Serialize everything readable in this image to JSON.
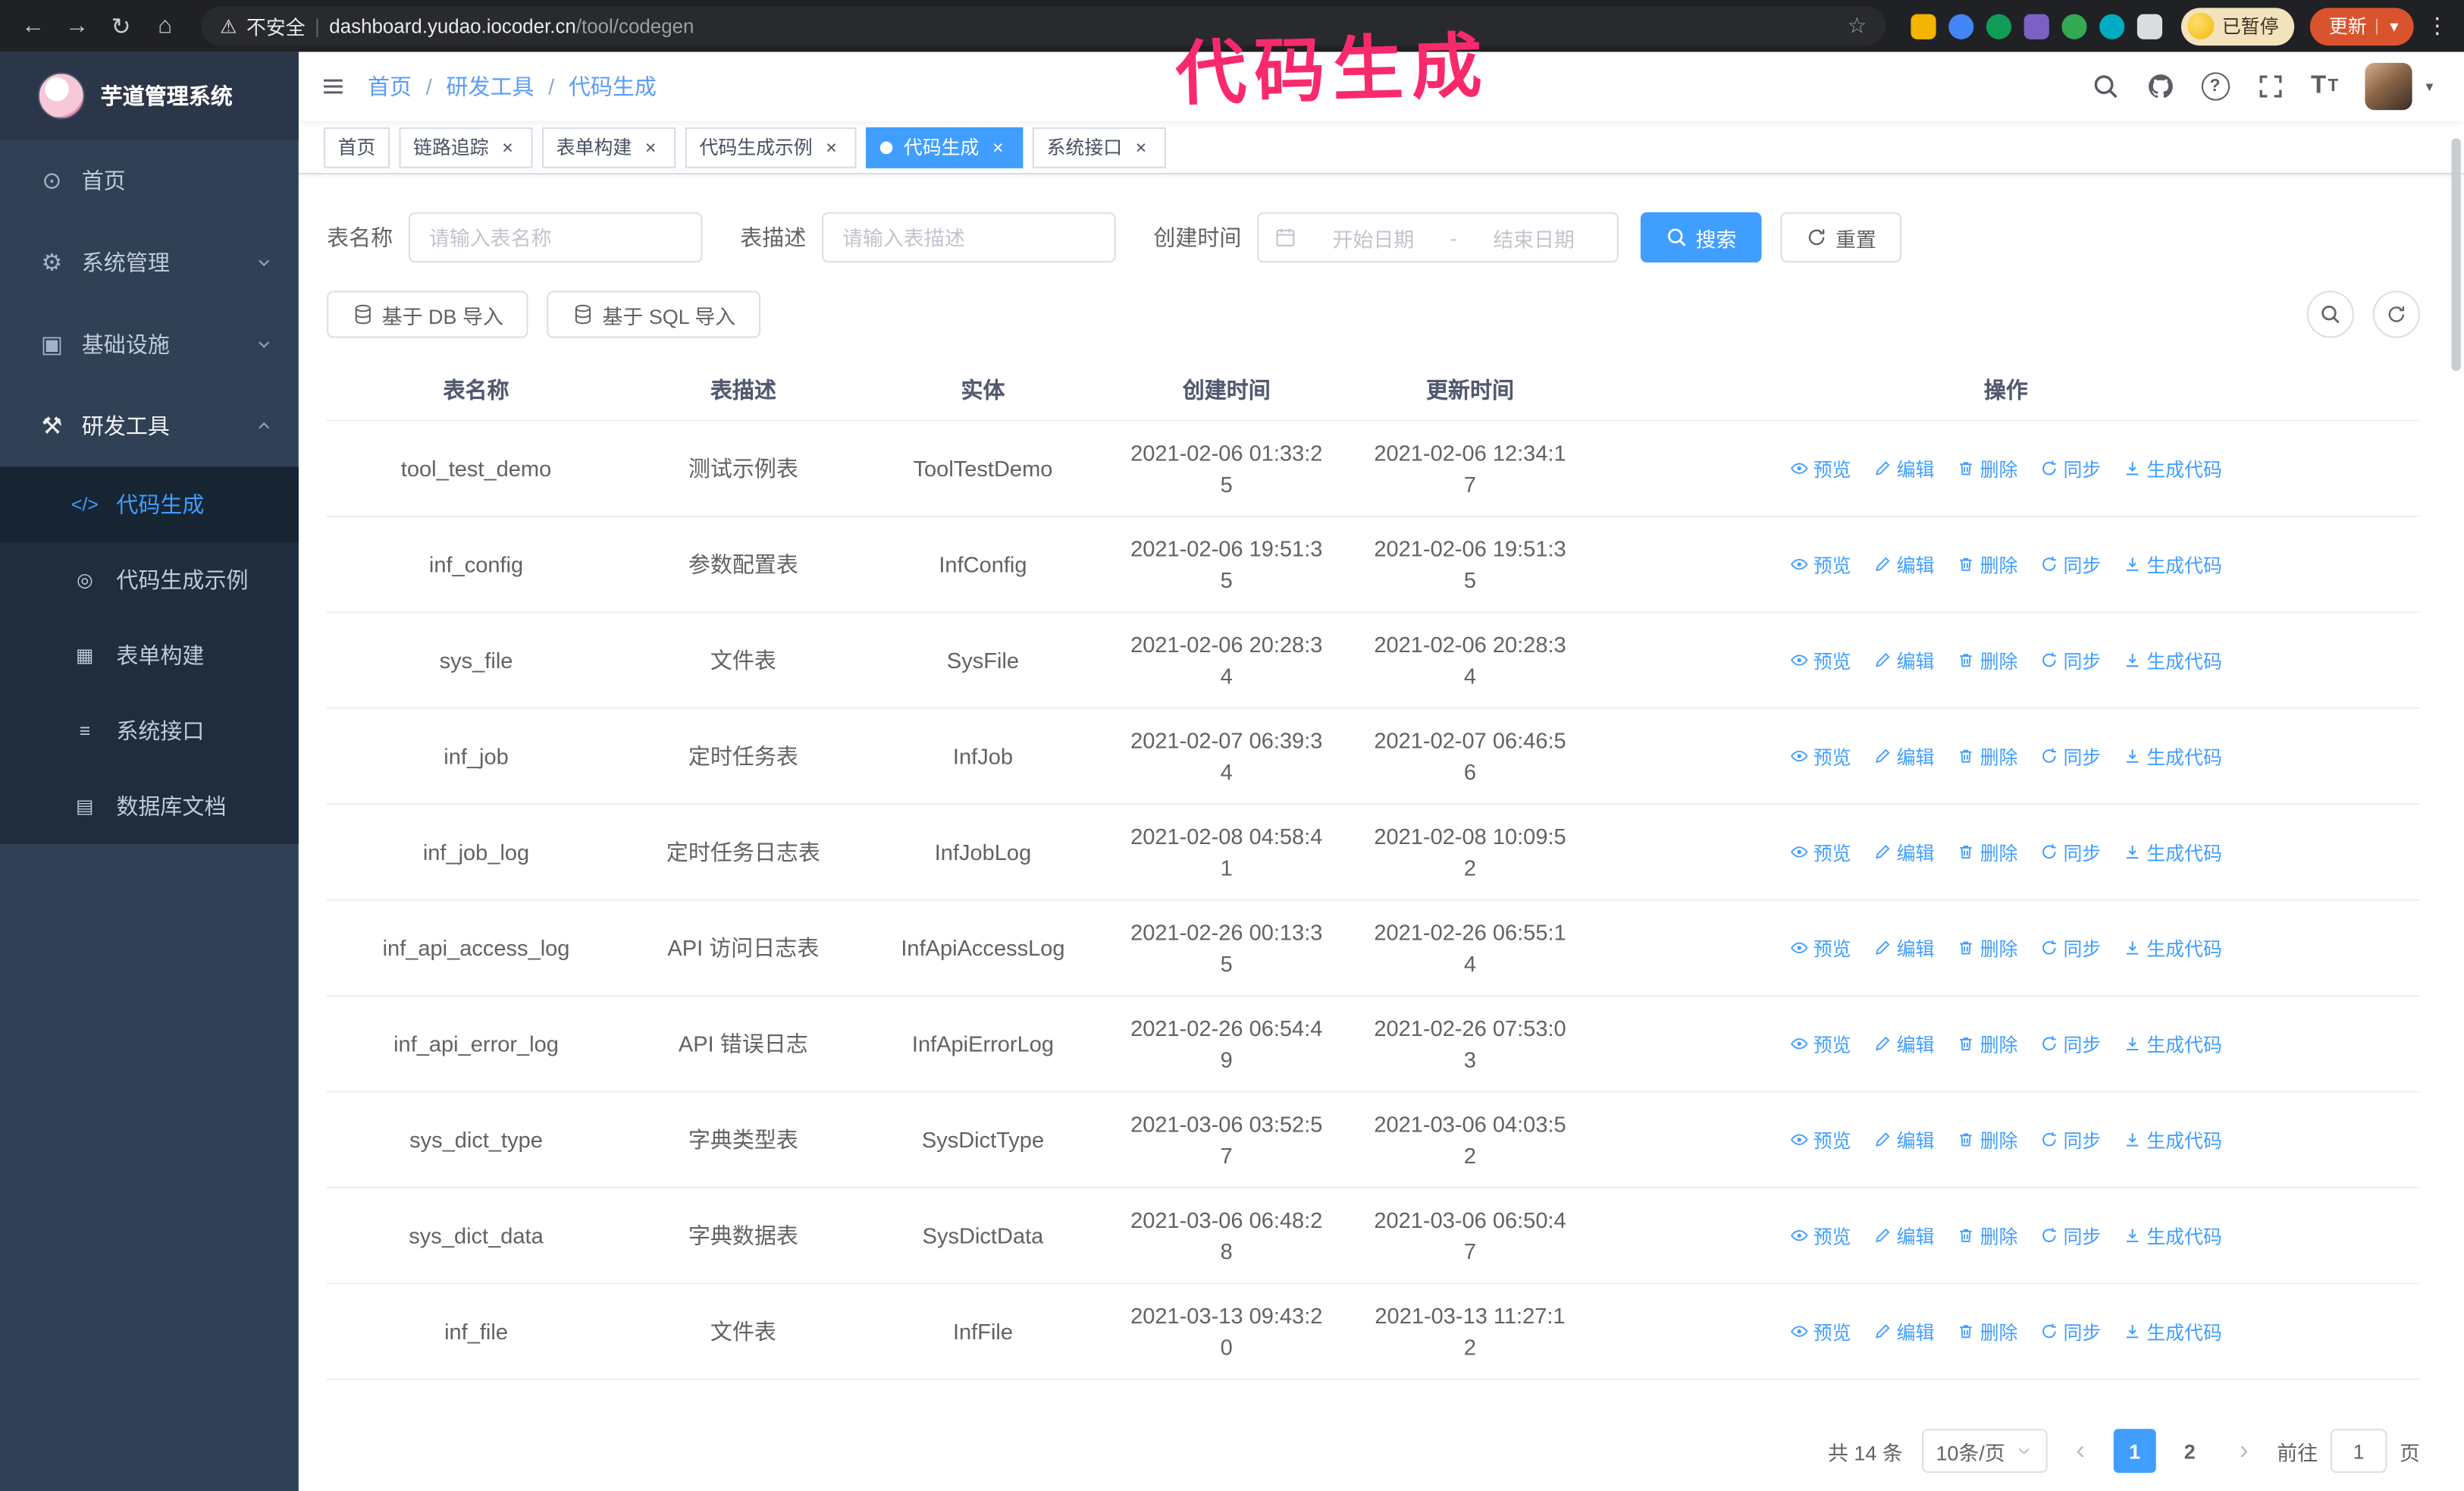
{
  "annotation": {
    "text": "代码生成"
  },
  "browser": {
    "security_label": "不安全",
    "url_host": "dashboard.yudao.iocoder.cn",
    "url_path": "/tool/codegen",
    "profile_badge": "已暂停",
    "update_button": "更新"
  },
  "icons": {
    "back": "←",
    "forward": "→",
    "reload": "↻",
    "home": "⌂",
    "warning": "⚠",
    "star": "☆",
    "kebab": "⋮",
    "close": "×",
    "question": "?",
    "t_large": "T",
    "t_small": "T",
    "avatar_caret": "▼",
    "dashboard": "⊙",
    "settings": "⚙",
    "infra": "▣",
    "tools": "⚒",
    "code": "</>",
    "example": "◎",
    "form": "▦",
    "api": "≡",
    "dbdoc": "▤"
  },
  "sidebar": {
    "logo_title": "芋道管理系统",
    "menu": [
      {
        "label": "首页"
      },
      {
        "label": "系统管理"
      },
      {
        "label": "基础设施"
      },
      {
        "label": "研发工具"
      }
    ],
    "submenu": [
      {
        "label": "代码生成"
      },
      {
        "label": "代码生成示例"
      },
      {
        "label": "表单构建"
      },
      {
        "label": "系统接口"
      },
      {
        "label": "数据库文档"
      }
    ]
  },
  "header": {
    "breadcrumb_separator": "/",
    "breadcrumb": [
      {
        "label": "首页"
      },
      {
        "label": "研发工具"
      },
      {
        "label": "代码生成"
      }
    ]
  },
  "tabs": [
    {
      "label": "首页"
    },
    {
      "label": "链路追踪"
    },
    {
      "label": "表单构建"
    },
    {
      "label": "代码生成示例"
    },
    {
      "label": "代码生成"
    },
    {
      "label": "系统接口"
    }
  ],
  "filters": {
    "table_name_label": "表名称",
    "table_name_placeholder": "请输入表名称",
    "table_desc_label": "表描述",
    "table_desc_placeholder": "请输入表描述",
    "create_time_label": "创建时间",
    "start_date_placeholder": "开始日期",
    "range_separator": "-",
    "end_date_placeholder": "结束日期",
    "search_button": "搜索",
    "reset_button": "重置"
  },
  "toolbar": {
    "import_db": "基于 DB 导入",
    "import_sql": "基于 SQL 导入"
  },
  "table": {
    "columns": [
      "表名称",
      "表描述",
      "实体",
      "创建时间",
      "更新时间",
      "操作"
    ],
    "actions": [
      "预览",
      "编辑",
      "删除",
      "同步",
      "生成代码"
    ],
    "rows": [
      {
        "name": "tool_test_demo",
        "desc": "测试示例表",
        "entity": "ToolTestDemo",
        "created": "2021-02-06 01:33:25",
        "updated": "2021-02-06 12:34:17"
      },
      {
        "name": "inf_config",
        "desc": "参数配置表",
        "entity": "InfConfig",
        "created": "2021-02-06 19:51:35",
        "updated": "2021-02-06 19:51:35"
      },
      {
        "name": "sys_file",
        "desc": "文件表",
        "entity": "SysFile",
        "created": "2021-02-06 20:28:34",
        "updated": "2021-02-06 20:28:34"
      },
      {
        "name": "inf_job",
        "desc": "定时任务表",
        "entity": "InfJob",
        "created": "2021-02-07 06:39:34",
        "updated": "2021-02-07 06:46:56"
      },
      {
        "name": "inf_job_log",
        "desc": "定时任务日志表",
        "entity": "InfJobLog",
        "created": "2021-02-08 04:58:41",
        "updated": "2021-02-08 10:09:52"
      },
      {
        "name": "inf_api_access_log",
        "desc": "API 访问日志表",
        "entity": "InfApiAccessLog",
        "created": "2021-02-26 00:13:35",
        "updated": "2021-02-26 06:55:14"
      },
      {
        "name": "inf_api_error_log",
        "desc": "API 错误日志",
        "entity": "InfApiErrorLog",
        "created": "2021-02-26 06:54:49",
        "updated": "2021-02-26 07:53:03"
      },
      {
        "name": "sys_dict_type",
        "desc": "字典类型表",
        "entity": "SysDictType",
        "created": "2021-03-06 03:52:57",
        "updated": "2021-03-06 04:03:52"
      },
      {
        "name": "sys_dict_data",
        "desc": "字典数据表",
        "entity": "SysDictData",
        "created": "2021-03-06 06:48:28",
        "updated": "2021-03-06 06:50:47"
      },
      {
        "name": "inf_file",
        "desc": "文件表",
        "entity": "InfFile",
        "created": "2021-03-13 09:43:20",
        "updated": "2021-03-13 11:27:12"
      }
    ]
  },
  "pagination": {
    "total": "共 14 条",
    "page_size": "10条/页",
    "prev_icon": "‹",
    "next_icon": "›",
    "pages": [
      "1",
      "2"
    ],
    "goto_label": "前往",
    "goto_value": "1",
    "goto_unit": "页"
  },
  "colors": {
    "accent_blue": "#409eff",
    "sidebar_bg": "#304156",
    "submenu_bg": "#1f2d3d",
    "annotation_pink": "#f92a6c"
  }
}
